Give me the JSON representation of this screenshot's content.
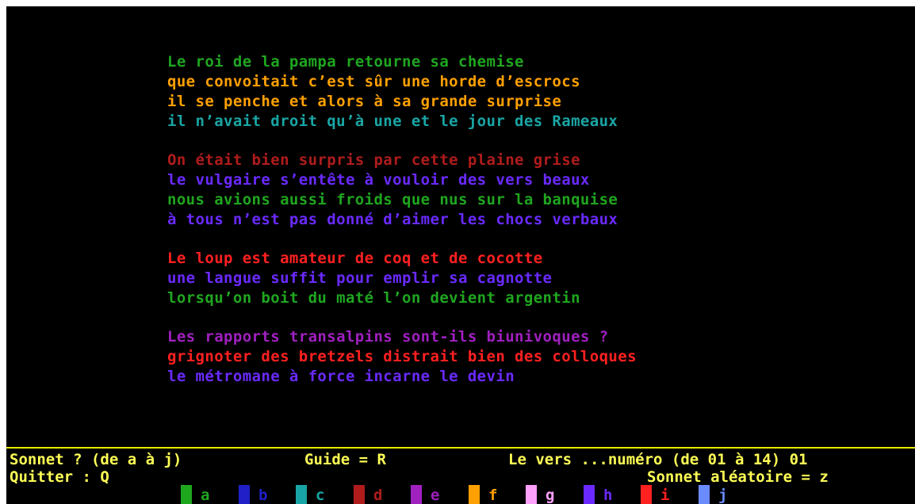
{
  "poem": {
    "stanzas": [
      {
        "lines": [
          {
            "text": "Le roi de la pampa retourne sa chemise",
            "color": "#1fa61f"
          },
          {
            "text": "que convoitait c’est sûr une horde d’escrocs",
            "color": "#ffa000"
          },
          {
            "text": "il se penche et alors à sa grande surprise",
            "color": "#ffa000"
          },
          {
            "text": "il n’avait droit qu’à une et le jour des Rameaux",
            "color": "#1aa5a5"
          }
        ]
      },
      {
        "lines": [
          {
            "text": "On était bien surpris par cette plaine grise",
            "color": "#b01c1c"
          },
          {
            "text": "le vulgaire s’entête à vouloir des vers beaux",
            "color": "#6a2aff"
          },
          {
            "text": "nous avions aussi froids que nus sur la banquise",
            "color": "#1fa61f"
          },
          {
            "text": "à tous n’est pas donné d’aimer les chocs verbaux",
            "color": "#6a2aff"
          }
        ]
      },
      {
        "lines": [
          {
            "text": "Le loup est amateur de coq et de cocotte",
            "color": "#ff2020"
          },
          {
            "text": "une langue suffit pour emplir sa cagnotte",
            "color": "#6a2aff"
          },
          {
            "text": "lorsqu’on boit du maté l’on devient argentin",
            "color": "#1fa61f"
          }
        ]
      },
      {
        "lines": [
          {
            "text": "Les rapports transalpins sont-ils biunivoques ?",
            "color": "#a020c0"
          },
          {
            "text": "grignoter des bretzels distrait bien des colloques",
            "color": "#ff2020"
          },
          {
            "text": "le métromane à force incarne le devin",
            "color": "#6a2aff"
          }
        ]
      }
    ]
  },
  "status": {
    "sonnet_prompt": "Sonnet ? (de a à j)",
    "guide": "Guide = R",
    "verse_prompt": "Le vers ...numéro (de 01 à 14) 01",
    "quit": "Quitter : Q",
    "random": "Sonnet aléatoire = z"
  },
  "swatches": [
    {
      "label": "a",
      "color": "#1fa61f"
    },
    {
      "label": "b",
      "color": "#2020c8"
    },
    {
      "label": "c",
      "color": "#1aa5a5"
    },
    {
      "label": "d",
      "color": "#b01c1c"
    },
    {
      "label": "e",
      "color": "#a020c0"
    },
    {
      "label": "f",
      "color": "#ffa000"
    },
    {
      "label": "g",
      "color": "#ffa0ff"
    },
    {
      "label": "h",
      "color": "#6a2aff"
    },
    {
      "label": "i",
      "color": "#ff2020"
    },
    {
      "label": "j",
      "color": "#6a8aff"
    }
  ],
  "colors": {
    "background": "#000000",
    "status_text": "#ffff55",
    "divider": "#e8e800"
  }
}
